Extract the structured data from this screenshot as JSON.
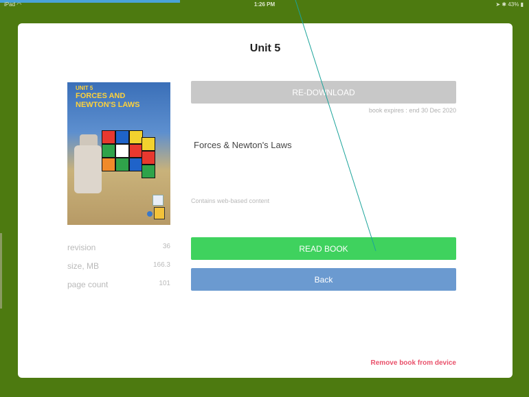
{
  "status_bar": {
    "carrier": "iPad",
    "time": "1:26 PM",
    "battery": "43%",
    "icons": [
      "wifi-icon",
      "location-icon",
      "bluetooth-icon",
      "battery-icon"
    ]
  },
  "dialog": {
    "title": "Unit 5",
    "cover": {
      "unit_label": "UNIT 5",
      "title_line": "FORCES AND NEWTON'S LAWS"
    },
    "meta": [
      {
        "label": "revision",
        "value": "36"
      },
      {
        "label": "size, MB",
        "value": "166.3"
      },
      {
        "label": "page count",
        "value": "101"
      }
    ],
    "redownload_label": "RE-DOWNLOAD",
    "expires": "book expires : end 30 Dec 2020",
    "book_name": "Forces & Newton's Laws",
    "web_content": "Contains web-based content",
    "read_label": "READ BOOK",
    "back_label": "Back",
    "remove_label": "Remove book from device"
  },
  "colors": {
    "background": "#4d7a10",
    "read_button": "#3fd25e",
    "back_button": "#6b9ad0",
    "redownload_button": "#c8c8c8",
    "remove_link": "#e9506a"
  }
}
